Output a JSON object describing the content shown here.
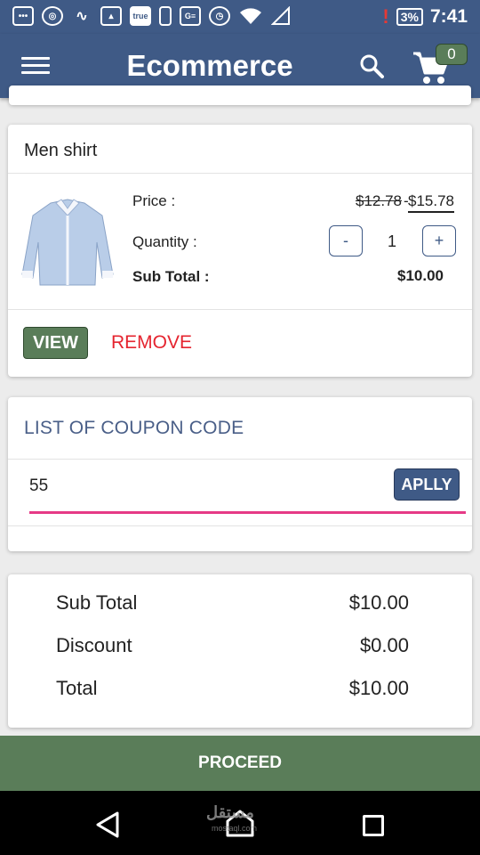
{
  "status_bar": {
    "icons": [
      "chat-icon",
      "chrome-icon",
      "pulse-icon",
      "image-icon",
      "true-icon",
      "sim-icon",
      "ge-icon",
      "alarm-icon",
      "wifi-icon",
      "signal-icon"
    ],
    "true_label": "true",
    "ge_label": "G≡",
    "battery_warning": "!",
    "battery": "3%",
    "time": "7:41"
  },
  "app_bar": {
    "title": "Ecommerce",
    "cart_count": "0"
  },
  "cart_item": {
    "name": "Men shirt",
    "price_label": "Price :",
    "price_old": "$12.78",
    "price_dash": "-",
    "price_new": "$15.78",
    "quantity_label": "Quantity :",
    "quantity_minus": "-",
    "quantity": "1",
    "quantity_plus": "+",
    "subtotal_label": "Sub Total :",
    "subtotal": "$10.00",
    "view_label": "VIEW",
    "remove_label": "REMOVE"
  },
  "coupon": {
    "title": "LIST OF COUPON CODE",
    "value": "55",
    "apply_label": "APLLY"
  },
  "totals": {
    "subtotal_label": "Sub Total",
    "subtotal": "$10.00",
    "discount_label": "Discount",
    "discount": "$0.00",
    "total_label": "Total",
    "total": "$10.00"
  },
  "proceed_label": "PROCEED",
  "watermark": {
    "text": "مستقل",
    "sub": "mostaql.com"
  },
  "colors": {
    "primary": "#3f5a86",
    "accent_green": "#5a7d59",
    "remove_red": "#e5242f",
    "input_underline": "#e63a86"
  }
}
